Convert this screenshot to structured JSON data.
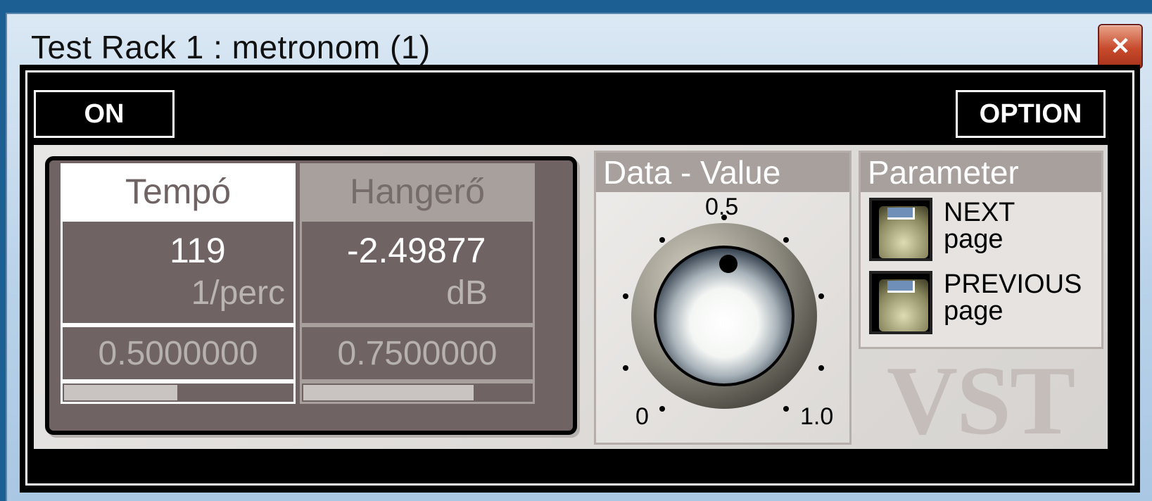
{
  "window": {
    "title": "Test Rack 1 : metronom (1)",
    "close_icon": "close-icon"
  },
  "toolbar": {
    "on_label": "ON",
    "option_label": "OPTION"
  },
  "params": [
    {
      "name": "Tempó",
      "value": "119",
      "unit": "1/perc",
      "normalized": "0.5000000",
      "level": 0.5,
      "selected": true
    },
    {
      "name": "Hangerő",
      "value": "-2.49877",
      "unit": "dB",
      "normalized": "0.7500000",
      "level": 0.75,
      "selected": false
    }
  ],
  "data_value": {
    "title": "Data - Value",
    "mid_label": "0.5",
    "min_label": "0",
    "max_label": "1.0",
    "knob_value": 0.5
  },
  "parameter": {
    "title": "Parameter",
    "next_line1": "NEXT",
    "next_line2": "page",
    "prev_line1": "PREVIOUS",
    "prev_line2": "page"
  },
  "logo": "VST",
  "colors": {
    "title_bar": "#b9d2ea",
    "close_button": "#c84a2c",
    "param_bg": "#6f6463",
    "selected_header": "#ffffff",
    "led_blue": "#6f8fb8"
  }
}
